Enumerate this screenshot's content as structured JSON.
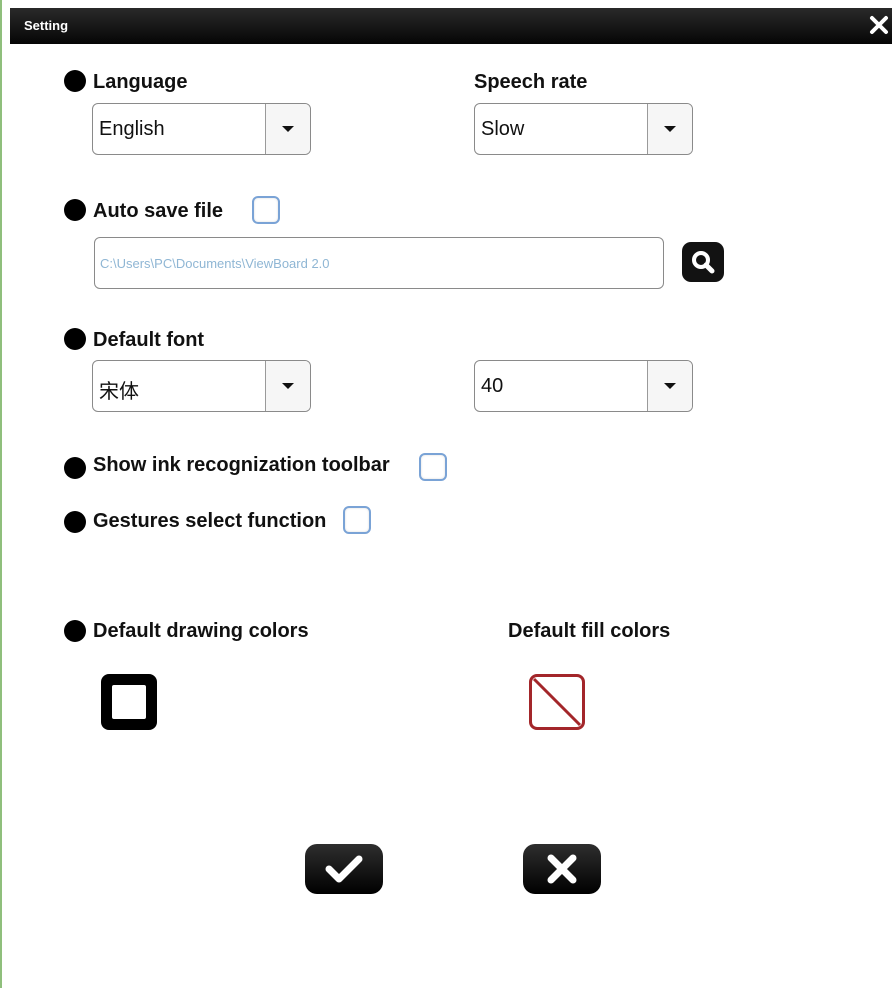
{
  "window": {
    "title": "Setting",
    "close_icon": "close-icon"
  },
  "language": {
    "label": "Language",
    "selected": "English"
  },
  "speech_rate": {
    "label": "Speech rate",
    "selected": "Slow"
  },
  "auto_save": {
    "label": "Auto save file",
    "checked": false,
    "path_prefix": "C:\\Users\\PC\\Documents\\",
    "path_folder": "ViewBoard 2.0",
    "browse_icon": "search-icon"
  },
  "default_font": {
    "label": "Default font",
    "family": "宋体",
    "size": "40"
  },
  "ink_toolbar": {
    "label": "Show ink recognization toolbar",
    "checked": false
  },
  "gestures": {
    "label": "Gestures select function",
    "checked": false
  },
  "drawing_colors": {
    "label": "Default drawing colors",
    "color": "#000000"
  },
  "fill_colors": {
    "label": "Default fill colors",
    "color": "none",
    "accent": "#a3262a"
  },
  "actions": {
    "ok_icon": "check-icon",
    "cancel_icon": "close-icon"
  }
}
